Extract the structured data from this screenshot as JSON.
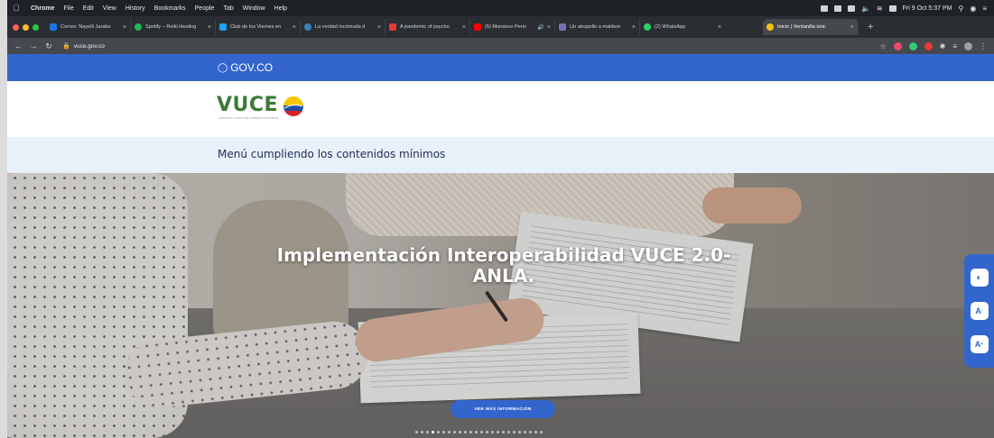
{
  "mac_menu": {
    "app": "Chrome",
    "items": [
      "File",
      "Edit",
      "View",
      "History",
      "Bookmarks",
      "People",
      "Tab",
      "Window",
      "Help"
    ],
    "clock": "Fri 9 Oct  5:37 PM"
  },
  "tabs": [
    {
      "label": "Correo: Nayelli Jarabo",
      "color": "#1a73e8"
    },
    {
      "label": "Spotify – Reiki Healing",
      "color": "#1db954"
    },
    {
      "label": "Club de los Viernes en",
      "color": "#1da1f2"
    },
    {
      "label": "La verdad incómoda d",
      "color": "#3b82c4"
    },
    {
      "label": "A pandemic of psycho",
      "color": "#e53935"
    },
    {
      "label": "(5) Monsieur Perin",
      "color": "#ff0000"
    },
    {
      "label": "Un atropello a maldem",
      "color": "#7a6fb0"
    },
    {
      "label": "(2) WhatsApp",
      "color": "#25d366"
    }
  ],
  "active_tab": {
    "label": "Inicio | Ventanilla únic",
    "color": "#f5c211"
  },
  "address_bar": {
    "url": "vuce.gov.co"
  },
  "page": {
    "gov_brand": "GOV.CO",
    "logo_text": "VUCE",
    "logo_sub": "VENTANILLA ÚNICA DE COMERCIO EXTERIOR",
    "menu_notice": "Menú cumpliendo los contenidos mínimos",
    "hero": {
      "title": "Implementación Interoperabilidad VUCE 2.0- ANLA.",
      "button": "VER MÁS INFORMACIÓN",
      "slides": 24,
      "active_slide": 3
    },
    "accessibility": {
      "contrast_icon": "contrast-icon",
      "decrease_label": "A-",
      "increase_label": "A+"
    }
  },
  "colors": {
    "gov_blue": "#3366cc",
    "vuce_green": "#3b7a37",
    "menu_bg": "#e8f0fa"
  }
}
